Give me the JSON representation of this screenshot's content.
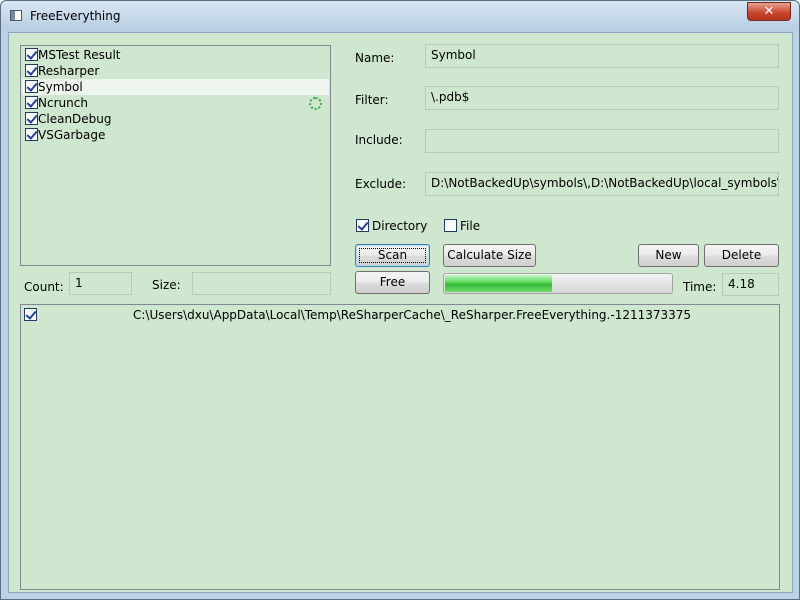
{
  "window": {
    "title": "FreeEverything",
    "close_glyph": "✕"
  },
  "profiles": [
    {
      "label": "MSTest Result",
      "checked": true
    },
    {
      "label": "Resharper",
      "checked": true
    },
    {
      "label": "Symbol",
      "checked": true,
      "selected": true
    },
    {
      "label": "Ncrunch",
      "checked": true,
      "busy": true
    },
    {
      "label": "CleanDebug",
      "checked": true
    },
    {
      "label": "VSGarbage",
      "checked": true
    }
  ],
  "stats": {
    "count_label": "Count:",
    "count_value": "1",
    "size_label": "Size:",
    "size_value": ""
  },
  "form": {
    "name_label": "Name:",
    "name_value": "Symbol",
    "filter_label": "Filter:",
    "filter_value": "\\.pdb$",
    "include_label": "Include:",
    "include_value": "",
    "exclude_label": "Exclude:",
    "exclude_value": "D:\\NotBackedUp\\symbols\\,D:\\NotBackedUp\\local_symbols\\,",
    "directory_label": "Directory",
    "directory_checked": true,
    "file_label": "File",
    "file_checked": false
  },
  "buttons": {
    "scan": "Scan",
    "calculate_size": "Calculate Size",
    "new": "New",
    "delete": "Delete",
    "free": "Free"
  },
  "progress": {
    "fraction": 0.48
  },
  "time": {
    "label": "Time:",
    "value": "4.18"
  },
  "results": [
    {
      "path": "C:\\Users\\dxu\\AppData\\Local\\Temp\\ReSharperCache\\_ReSharper.FreeEverything.-1211373375",
      "checked": true
    }
  ],
  "colors": {
    "panel_bg": "#cfe7cf",
    "progress_fill": "#37b737"
  },
  "icons": {
    "app": "window-icon",
    "close": "close-icon",
    "busy": "spinner-icon"
  }
}
